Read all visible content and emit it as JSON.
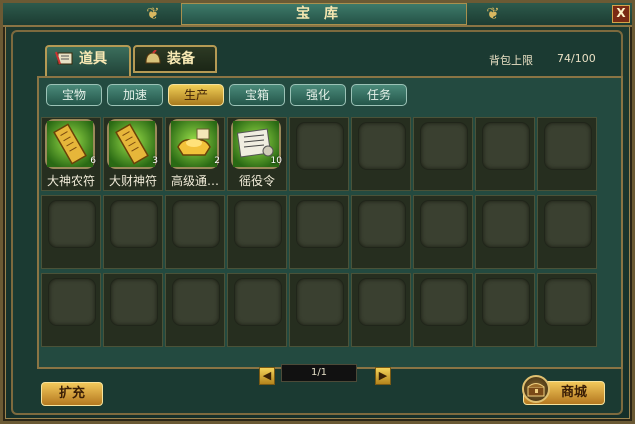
{
  "window": {
    "title": "宝库",
    "close_label": "X"
  },
  "tabs": [
    {
      "label": "道具",
      "icon": "bag-icon",
      "active": true
    },
    {
      "label": "装备",
      "icon": "helmet-icon",
      "active": false
    }
  ],
  "capacity": {
    "label": "背包上限",
    "value": "74/100"
  },
  "subtabs": [
    {
      "label": "宝物",
      "selected": false
    },
    {
      "label": "加速",
      "selected": false
    },
    {
      "label": "生产",
      "selected": true
    },
    {
      "label": "宝箱",
      "selected": false
    },
    {
      "label": "强化",
      "selected": false
    },
    {
      "label": "任务",
      "selected": false
    }
  ],
  "items": [
    {
      "name": "大神农符",
      "qty": "6",
      "icon": "talisman-icon"
    },
    {
      "name": "大财神符",
      "qty": "3",
      "icon": "talisman-icon"
    },
    {
      "name": "高级通…",
      "qty": "2",
      "icon": "gold-ingot-icon"
    },
    {
      "name": "徭役令",
      "qty": "10",
      "icon": "decree-scroll-icon"
    }
  ],
  "grid": {
    "columns": 9,
    "rows": 3
  },
  "pager": {
    "prev": "◀",
    "next": "▶",
    "text": "1/1"
  },
  "buttons": {
    "expand": "扩充",
    "shop": "商城"
  },
  "colors": {
    "accent_gold": "#f2c85a",
    "panel_teal": "#234a40",
    "border_bronze": "#8a7444"
  }
}
